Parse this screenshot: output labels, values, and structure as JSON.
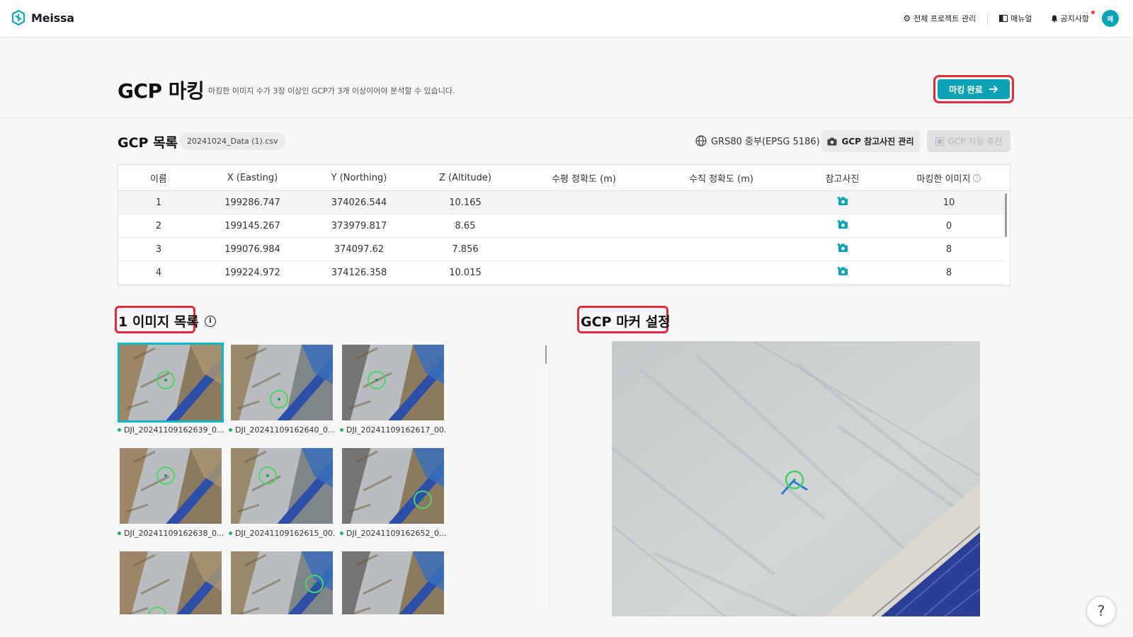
{
  "app": {
    "name": "Meissa"
  },
  "nav": {
    "projects": "전체 프로젝트 관리",
    "manual": "매뉴얼",
    "notice": "공지사항",
    "avatar": "메"
  },
  "header": {
    "title": "GCP 마킹",
    "subtitle": "마킹한 이미지 수가 3장 이상인 GCP가 3개 이상이어야 분석할 수 있습니다.",
    "done_label": "마킹 완료"
  },
  "gcp_list": {
    "title": "GCP 목록",
    "file": "20241024_Data (1).csv",
    "coord_system": "GRS80 중부(EPSG 5186)",
    "ref_photo_label": "GCP 참고사진 관리",
    "auto_label": "GCP 자동 추천",
    "columns": [
      "이름",
      "X (Easting)",
      "Y (Northing)",
      "Z (Altitude)",
      "수평 정확도 (m)",
      "수직 정확도 (m)",
      "참고사진",
      "마킹한 이미지"
    ],
    "rows": [
      {
        "name": "1",
        "x": "199286.747",
        "y": "374026.544",
        "z": "10.165",
        "h_acc": "",
        "v_acc": "",
        "marked": "10"
      },
      {
        "name": "2",
        "x": "199145.267",
        "y": "373979.817",
        "z": "8.65",
        "h_acc": "",
        "v_acc": "",
        "marked": "0"
      },
      {
        "name": "3",
        "x": "199076.984",
        "y": "374097.62",
        "z": "7.856",
        "h_acc": "",
        "v_acc": "",
        "marked": "8"
      },
      {
        "name": "4",
        "x": "199224.972",
        "y": "374126.358",
        "z": "10.015",
        "h_acc": "",
        "v_acc": "",
        "marked": "8"
      }
    ]
  },
  "image_list": {
    "title": "1 이미지 목록",
    "images": [
      {
        "label": "DJI_20241109162639_0..."
      },
      {
        "label": "DJI_20241109162640_0..."
      },
      {
        "label": "DJI_20241109162617_00..."
      },
      {
        "label": "DJI_20241109162638_0..."
      },
      {
        "label": "DJI_20241109162615_00..."
      },
      {
        "label": "DJI_20241109162652_0..."
      },
      {
        "label": ""
      },
      {
        "label": ""
      },
      {
        "label": ""
      }
    ]
  },
  "marker_panel": {
    "title": "GCP 마커 설정"
  },
  "help": {
    "label": "?"
  },
  "colors": {
    "accent": "#0aa3b3",
    "highlight": "#e22b3a",
    "marker": "#4fd46a"
  }
}
